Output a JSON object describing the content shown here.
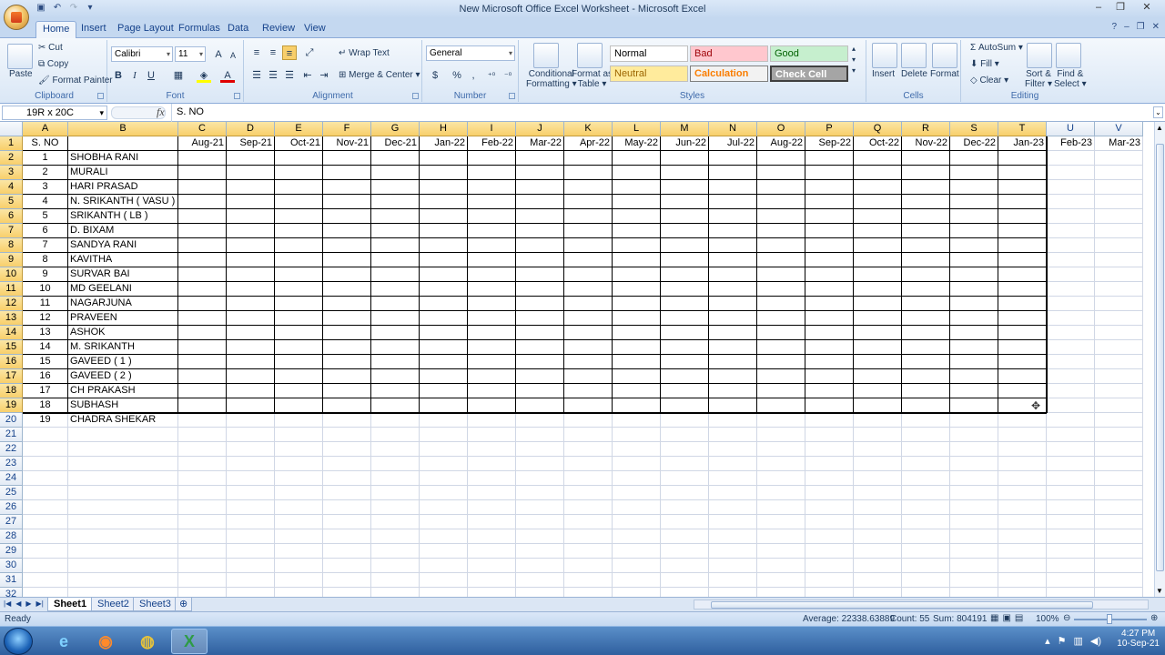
{
  "window": {
    "title": "New Microsoft Office Excel Worksheet - Microsoft Excel",
    "min": "–",
    "max": "❐",
    "close": "✕"
  },
  "tabs": [
    "Home",
    "Insert",
    "Page Layout",
    "Formulas",
    "Data",
    "Review",
    "View"
  ],
  "ribbon": {
    "clipboard": {
      "label": "Clipboard",
      "paste": "Paste",
      "cut": "Cut",
      "copy": "Copy",
      "format_painter": "Format Painter"
    },
    "font": {
      "label": "Font",
      "name": "Calibri",
      "size": "11",
      "bold": "B",
      "italic": "I",
      "underline": "U"
    },
    "alignment": {
      "label": "Alignment",
      "wrap": "Wrap Text",
      "merge": "Merge & Center"
    },
    "number": {
      "label": "Number",
      "format": "General",
      "currency": "$",
      "percent": "%",
      "comma": ","
    },
    "styles": {
      "label": "Styles",
      "conditional": "Conditional",
      "conditional2": "Formatting",
      "format_table": "Format as",
      "format_table2": "Table",
      "normal": "Normal",
      "bad": "Bad",
      "good": "Good",
      "neutral": "Neutral",
      "calculation": "Calculation",
      "check": "Check Cell"
    },
    "cells": {
      "label": "Cells",
      "insert": "Insert",
      "delete": "Delete",
      "format": "Format"
    },
    "editing": {
      "label": "Editing",
      "autosum": "AutoSum",
      "fill": "Fill",
      "clear": "Clear",
      "sort": "Sort &",
      "sort2": "Filter",
      "find": "Find &",
      "find2": "Select"
    }
  },
  "formula_bar": {
    "name_box": "19R x 20C",
    "fx": "fx",
    "value": "S. NO"
  },
  "columns": [
    "A",
    "B",
    "C",
    "D",
    "E",
    "F",
    "G",
    "H",
    "I",
    "J",
    "K",
    "L",
    "M",
    "N",
    "O",
    "P",
    "Q",
    "R",
    "S",
    "T",
    "U",
    "V"
  ],
  "header_row": [
    "S. NO",
    "",
    "Aug-21",
    "Sep-21",
    "Oct-21",
    "Nov-21",
    "Dec-21",
    "Jan-22",
    "Feb-22",
    "Mar-22",
    "Apr-22",
    "May-22",
    "Jun-22",
    "Jul-22",
    "Aug-22",
    "Sep-22",
    "Oct-22",
    "Nov-22",
    "Dec-22",
    "Jan-23",
    "Feb-23",
    "Mar-23"
  ],
  "rows": [
    [
      "1",
      "SHOBHA RANI"
    ],
    [
      "2",
      "MURALI"
    ],
    [
      "3",
      "HARI PRASAD"
    ],
    [
      "4",
      "N. SRIKANTH ( VASU )"
    ],
    [
      "5",
      "SRIKANTH ( LB )"
    ],
    [
      "6",
      "D. BIXAM"
    ],
    [
      "7",
      "SANDYA RANI"
    ],
    [
      "8",
      "KAVITHA"
    ],
    [
      "9",
      "SURVAR BAI"
    ],
    [
      "10",
      "MD GEELANI"
    ],
    [
      "11",
      "NAGARJUNA"
    ],
    [
      "12",
      "PRAVEEN"
    ],
    [
      "13",
      "ASHOK"
    ],
    [
      "14",
      "M. SRIKANTH"
    ],
    [
      "15",
      "GAVEED ( 1 )"
    ],
    [
      "16",
      "GAVEED ( 2 )"
    ],
    [
      "17",
      "CH PRAKASH"
    ],
    [
      "18",
      "SUBHASH"
    ],
    [
      "19",
      "CHADRA SHEKAR"
    ]
  ],
  "row_numbers": [
    "1",
    "2",
    "3",
    "4",
    "5",
    "6",
    "7",
    "8",
    "9",
    "10",
    "11",
    "12",
    "13",
    "14",
    "15",
    "16",
    "17",
    "18",
    "19",
    "20",
    "21",
    "22",
    "23",
    "24",
    "25",
    "26",
    "27",
    "28",
    "29",
    "30",
    "31",
    "32"
  ],
  "sheets": [
    "Sheet1",
    "Sheet2",
    "Sheet3"
  ],
  "status": {
    "ready": "Ready",
    "average": "Average: 22338.63889",
    "count": "Count: 55",
    "sum": "Sum: 804191",
    "zoom": "100%"
  },
  "taskbar": {
    "time": "4:27 PM",
    "date": "10-Sep-21"
  },
  "colors": {
    "selection_header": "#f8cf6b",
    "ribbon": "#dae7f6",
    "bad_bg": "#ffc7ce",
    "good_bg": "#c6efce",
    "neutral_bg": "#ffeb9c",
    "check_bg": "#a5a5a5"
  }
}
